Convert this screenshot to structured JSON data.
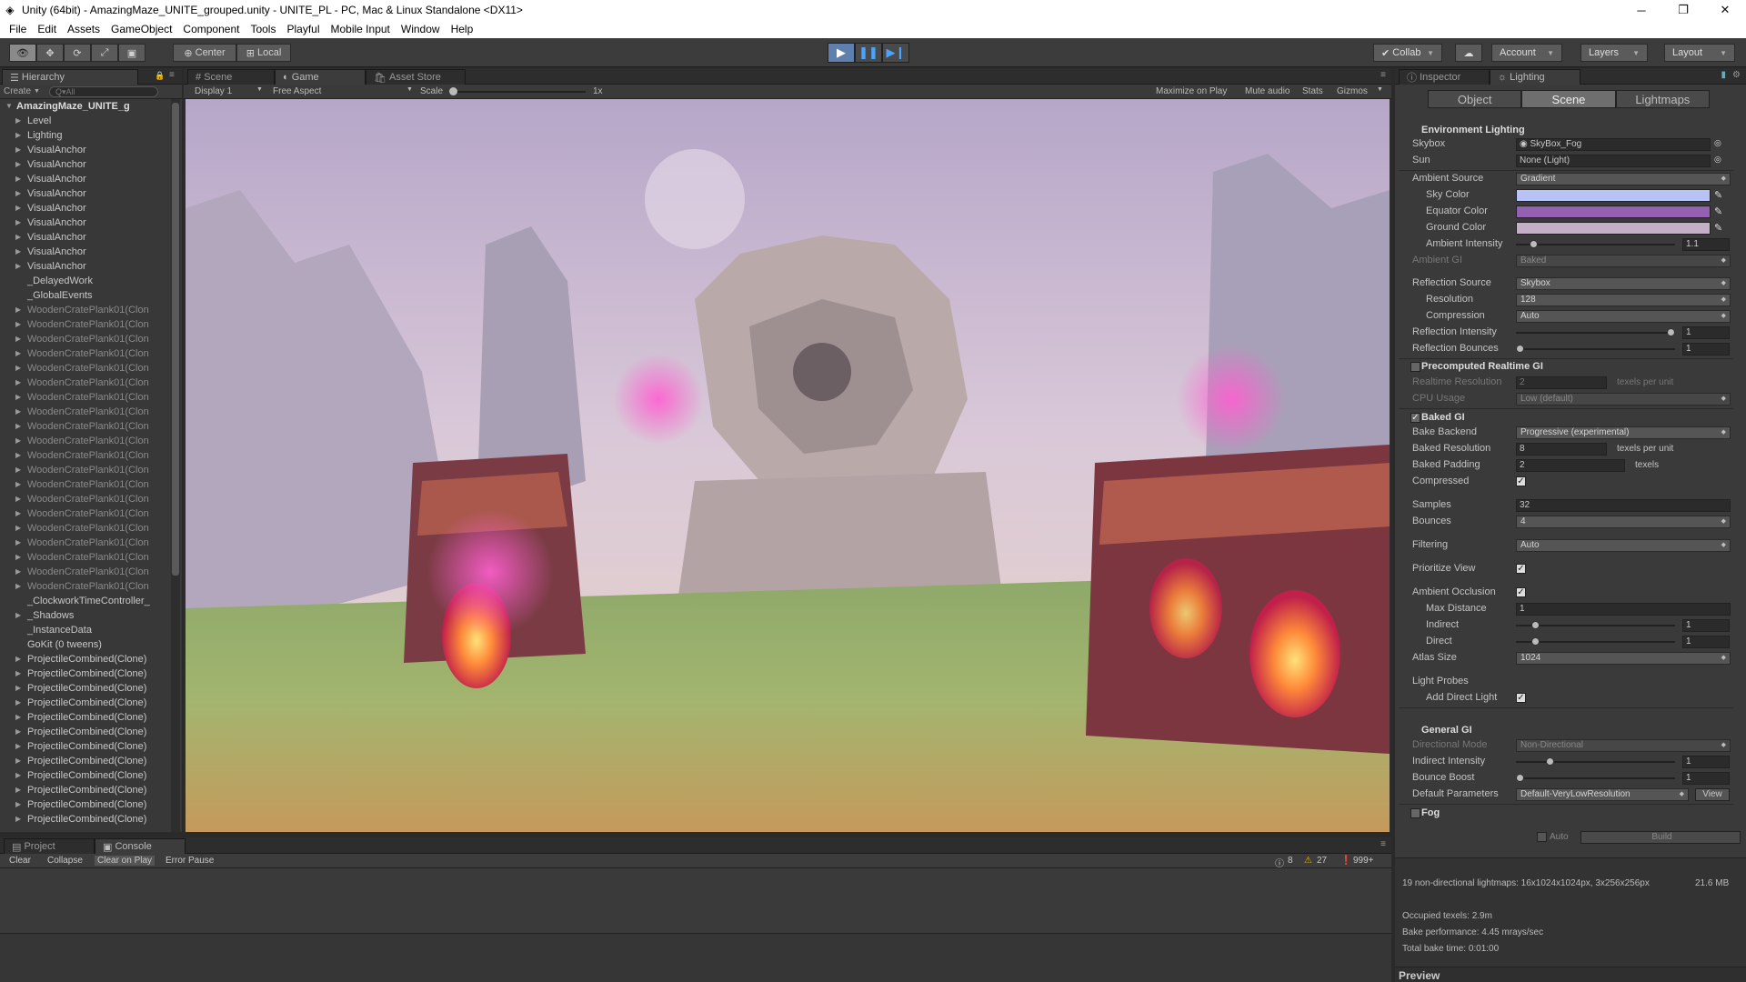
{
  "window": {
    "title": "Unity (64bit) - AmazingMaze_UNITE_grouped.unity - UNITE_PL - PC, Mac & Linux Standalone <DX11>"
  },
  "menu": [
    "File",
    "Edit",
    "Assets",
    "GameObject",
    "Component",
    "Tools",
    "Playful",
    "Mobile Input",
    "Window",
    "Help"
  ],
  "toolbar": {
    "center": "Center",
    "local": "Local",
    "collab": "Collab",
    "account": "Account",
    "layers": "Layers",
    "layout": "Layout"
  },
  "hierarchy": {
    "tab": "Hierarchy",
    "create": "Create",
    "search_placeholder": "Q▾All",
    "root": "AmazingMaze_UNITE_g",
    "items": [
      {
        "label": "Level",
        "style": "n",
        "arrow": true
      },
      {
        "label": "Lighting",
        "style": "n",
        "arrow": true
      },
      {
        "label": "VisualAnchor",
        "style": "n",
        "arrow": true
      },
      {
        "label": "VisualAnchor",
        "style": "n",
        "arrow": true
      },
      {
        "label": "VisualAnchor",
        "style": "n",
        "arrow": true
      },
      {
        "label": "VisualAnchor",
        "style": "n",
        "arrow": true
      },
      {
        "label": "VisualAnchor",
        "style": "n",
        "arrow": true
      },
      {
        "label": "VisualAnchor",
        "style": "n",
        "arrow": true
      },
      {
        "label": "VisualAnchor",
        "style": "n",
        "arrow": true
      },
      {
        "label": "VisualAnchor",
        "style": "n",
        "arrow": true
      },
      {
        "label": "VisualAnchor",
        "style": "n",
        "arrow": true
      },
      {
        "label": "_DelayedWork",
        "style": "n",
        "arrow": false
      },
      {
        "label": "_GlobalEvents",
        "style": "n",
        "arrow": false
      },
      {
        "label": "WoodenCratePlank01(Clon",
        "style": "d",
        "arrow": true
      },
      {
        "label": "WoodenCratePlank01(Clon",
        "style": "d",
        "arrow": true
      },
      {
        "label": "WoodenCratePlank01(Clon",
        "style": "d",
        "arrow": true
      },
      {
        "label": "WoodenCratePlank01(Clon",
        "style": "d",
        "arrow": true
      },
      {
        "label": "WoodenCratePlank01(Clon",
        "style": "d",
        "arrow": true
      },
      {
        "label": "WoodenCratePlank01(Clon",
        "style": "d",
        "arrow": true
      },
      {
        "label": "WoodenCratePlank01(Clon",
        "style": "d",
        "arrow": true
      },
      {
        "label": "WoodenCratePlank01(Clon",
        "style": "d",
        "arrow": true
      },
      {
        "label": "WoodenCratePlank01(Clon",
        "style": "d",
        "arrow": true
      },
      {
        "label": "WoodenCratePlank01(Clon",
        "style": "d",
        "arrow": true
      },
      {
        "label": "WoodenCratePlank01(Clon",
        "style": "d",
        "arrow": true
      },
      {
        "label": "WoodenCratePlank01(Clon",
        "style": "d",
        "arrow": true
      },
      {
        "label": "WoodenCratePlank01(Clon",
        "style": "d",
        "arrow": true
      },
      {
        "label": "WoodenCratePlank01(Clon",
        "style": "d",
        "arrow": true
      },
      {
        "label": "WoodenCratePlank01(Clon",
        "style": "d",
        "arrow": true
      },
      {
        "label": "WoodenCratePlank01(Clon",
        "style": "d",
        "arrow": true
      },
      {
        "label": "WoodenCratePlank01(Clon",
        "style": "d",
        "arrow": true
      },
      {
        "label": "WoodenCratePlank01(Clon",
        "style": "d",
        "arrow": true
      },
      {
        "label": "WoodenCratePlank01(Clon",
        "style": "d",
        "arrow": true
      },
      {
        "label": "WoodenCratePlank01(Clon",
        "style": "d",
        "arrow": true
      },
      {
        "label": "_ClockworkTimeController_",
        "style": "n",
        "arrow": false
      },
      {
        "label": "_Shadows",
        "style": "n",
        "arrow": true
      },
      {
        "label": "_InstanceData",
        "style": "n",
        "arrow": false
      },
      {
        "label": "GoKit (0 tweens)",
        "style": "n",
        "arrow": false
      },
      {
        "label": "ProjectileCombined(Clone)",
        "style": "n",
        "arrow": true
      },
      {
        "label": "ProjectileCombined(Clone)",
        "style": "n",
        "arrow": true
      },
      {
        "label": "ProjectileCombined(Clone)",
        "style": "n",
        "arrow": true
      },
      {
        "label": "ProjectileCombined(Clone)",
        "style": "n",
        "arrow": true
      },
      {
        "label": "ProjectileCombined(Clone)",
        "style": "n",
        "arrow": true
      },
      {
        "label": "ProjectileCombined(Clone)",
        "style": "n",
        "arrow": true
      },
      {
        "label": "ProjectileCombined(Clone)",
        "style": "n",
        "arrow": true
      },
      {
        "label": "ProjectileCombined(Clone)",
        "style": "n",
        "arrow": true
      },
      {
        "label": "ProjectileCombined(Clone)",
        "style": "n",
        "arrow": true
      },
      {
        "label": "ProjectileCombined(Clone)",
        "style": "n",
        "arrow": true
      },
      {
        "label": "ProjectileCombined(Clone)",
        "style": "n",
        "arrow": true
      },
      {
        "label": "ProjectileCombined(Clone)",
        "style": "n",
        "arrow": true
      }
    ]
  },
  "game": {
    "tabs": [
      "Scene",
      "Game",
      "Asset Store"
    ],
    "display": "Display 1",
    "aspect": "Free Aspect",
    "scale_label": "Scale",
    "scale_value": "1x",
    "maximize": "Maximize on Play",
    "mute": "Mute audio",
    "stats": "Stats",
    "gizmos": "Gizmos"
  },
  "console": {
    "tabs": [
      "Project",
      "Console"
    ],
    "clear": "Clear",
    "collapse": "Collapse",
    "clear_on_play": "Clear on Play",
    "error_pause": "Error Pause",
    "info_count": "8",
    "warn_count": "27",
    "error_count": "999+"
  },
  "inspector": {
    "tabs": [
      "Inspector",
      "Lighting"
    ],
    "scene_tabs": [
      "Object",
      "Scene",
      "Lightmaps"
    ],
    "env_header": "Environment Lighting",
    "skybox": {
      "label": "Skybox",
      "value": "SkyBox_Fog"
    },
    "sun": {
      "label": "Sun",
      "value": "None (Light)"
    },
    "ambient_source": {
      "label": "Ambient Source",
      "value": "Gradient"
    },
    "sky_color": {
      "label": "Sky Color",
      "color": "#b9c2f6"
    },
    "equator_color": {
      "label": "Equator Color",
      "color": "#9461b2"
    },
    "ground_color": {
      "label": "Ground Color",
      "color": "#c3b0c6"
    },
    "ambient_intensity": {
      "label": "Ambient Intensity",
      "value": "1.1",
      "level": 0.09
    },
    "ambient_gi": {
      "label": "Ambient GI",
      "value": "Baked"
    },
    "reflection_source": {
      "label": "Reflection Source",
      "value": "Skybox"
    },
    "resolution": {
      "label": "Resolution",
      "value": "128"
    },
    "compression": {
      "label": "Compression",
      "value": "Auto"
    },
    "reflection_intensity": {
      "label": "Reflection Intensity",
      "value": "1",
      "level": 1.0
    },
    "reflection_bounces": {
      "label": "Reflection Bounces",
      "value": "1",
      "level": 0.0
    },
    "precomputed_header": "Precomputed Realtime GI",
    "realtime_resolution": {
      "label": "Realtime Resolution",
      "value": "2",
      "unit": "texels per unit"
    },
    "cpu_usage": {
      "label": "CPU Usage",
      "value": "Low (default)"
    },
    "baked_header": "Baked GI",
    "bake_backend": {
      "label": "Bake Backend",
      "value": "Progressive (experimental)"
    },
    "baked_resolution": {
      "label": "Baked Resolution",
      "value": "8",
      "unit": "texels per unit"
    },
    "baked_padding": {
      "label": "Baked Padding",
      "value": "2",
      "unit": "texels"
    },
    "compressed": {
      "label": "Compressed"
    },
    "samples": {
      "label": "Samples",
      "value": "32"
    },
    "bounces": {
      "label": "Bounces",
      "value": "4"
    },
    "filtering": {
      "label": "Filtering",
      "value": "Auto"
    },
    "prioritize_view": {
      "label": "Prioritize View"
    },
    "ambient_occlusion": {
      "label": "Ambient Occlusion"
    },
    "max_distance": {
      "label": "Max Distance",
      "value": "1"
    },
    "indirect": {
      "label": "Indirect",
      "value": "1",
      "level": 0.1
    },
    "direct": {
      "label": "Direct",
      "value": "1",
      "level": 0.1
    },
    "atlas_size": {
      "label": "Atlas Size",
      "value": "1024"
    },
    "light_probes": {
      "label": "Light Probes"
    },
    "add_direct_light": {
      "label": "Add Direct Light"
    },
    "general_header": "General GI",
    "directional_mode": {
      "label": "Directional Mode",
      "value": "Non-Directional"
    },
    "indirect_intensity": {
      "label": "Indirect Intensity",
      "value": "1",
      "level": 0.2
    },
    "bounce_boost": {
      "label": "Bounce Boost",
      "value": "1",
      "level": 0.0
    },
    "default_parameters": {
      "label": "Default Parameters",
      "value": "Default-VeryLowResolution",
      "view": "View"
    },
    "fog_header": "Fog",
    "auto_label": "Auto",
    "build_label": "Build",
    "stats": {
      "line1": "19 non-directional lightmaps: 16x1024x1024px, 3x256x256px",
      "size": "21.6 MB",
      "occupied": "Occupied texels: 2.9m",
      "perf": "Bake performance: 4.45 mrays/sec",
      "total": "Total bake time: 0:01:00"
    },
    "preview": "Preview"
  }
}
